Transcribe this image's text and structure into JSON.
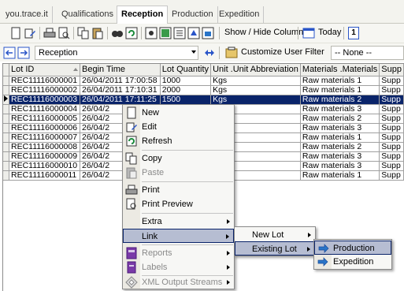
{
  "tabs": [
    "you.trace.it",
    "Qualifications",
    "Reception",
    "Production",
    "Expedition"
  ],
  "active_tab": "Reception",
  "toolbar": {
    "show_hide_columns": "Show / Hide Columns",
    "today": "Today",
    "today_badge": "1",
    "view_selector": "Reception",
    "customize_filter": "Customize User Filter",
    "filter_value": "-- None --"
  },
  "grid": {
    "columns": [
      "Lot ID",
      "Begin Time",
      "Lot Quantity",
      "Unit .Unit Abbreviation",
      "Materials .Materials",
      "Supp"
    ],
    "rows": [
      [
        "REC11116000001",
        "26/04/2011 17:00:58",
        "1000",
        "Kgs",
        "Raw materials 1",
        "Supp"
      ],
      [
        "REC11116000002",
        "26/04/2011 17:10:31",
        "2000",
        "Kgs",
        "Raw materials 1",
        "Supp"
      ],
      [
        "REC11116000003",
        "26/04/2011 17:11:25",
        "1500",
        "Kgs",
        "Raw materials 2",
        "Supp"
      ],
      [
        "REC11116000004",
        "26/04/2",
        "",
        "gs",
        "Raw materials 3",
        "Supp"
      ],
      [
        "REC11116000005",
        "26/04/2",
        "",
        "gs",
        "Raw materials 2",
        "Supp"
      ],
      [
        "REC11116000006",
        "26/04/2",
        "",
        "gs",
        "Raw materials 3",
        "Supp"
      ],
      [
        "REC11116000007",
        "26/04/2",
        "",
        "gs",
        "Raw materials 1",
        "Supp"
      ],
      [
        "REC11116000008",
        "26/04/2",
        "",
        "gs",
        "Raw materials 2",
        "Supp"
      ],
      [
        "REC11116000009",
        "26/04/2",
        "",
        "gs",
        "Raw materials 3",
        "Supp"
      ],
      [
        "REC11116000010",
        "26/04/2",
        "",
        "gs",
        "Raw materials 3",
        "Supp"
      ],
      [
        "REC11116000011",
        "26/04/2",
        "",
        "gs",
        "Raw materials 1",
        "Supp"
      ]
    ],
    "selected_row": 2
  },
  "context_menu": {
    "new": "New",
    "edit": "Edit",
    "refresh": "Refresh",
    "copy": "Copy",
    "paste": "Paste",
    "print": "Print",
    "print_preview": "Print Preview",
    "extra": "Extra",
    "link": "Link",
    "reports": "Reports",
    "labels": "Labels",
    "xml_output_streams": "XML Output Streams"
  },
  "link_submenu": {
    "new_lot": "New Lot",
    "existing_lot": "Existing Lot"
  },
  "existing_lot_submenu": {
    "production": "Production",
    "expedition": "Expedition"
  },
  "colors": {
    "selection": "#0a246a",
    "menu_highlight": "#b6bdd2",
    "tab_bar": "#f3f3ee"
  }
}
